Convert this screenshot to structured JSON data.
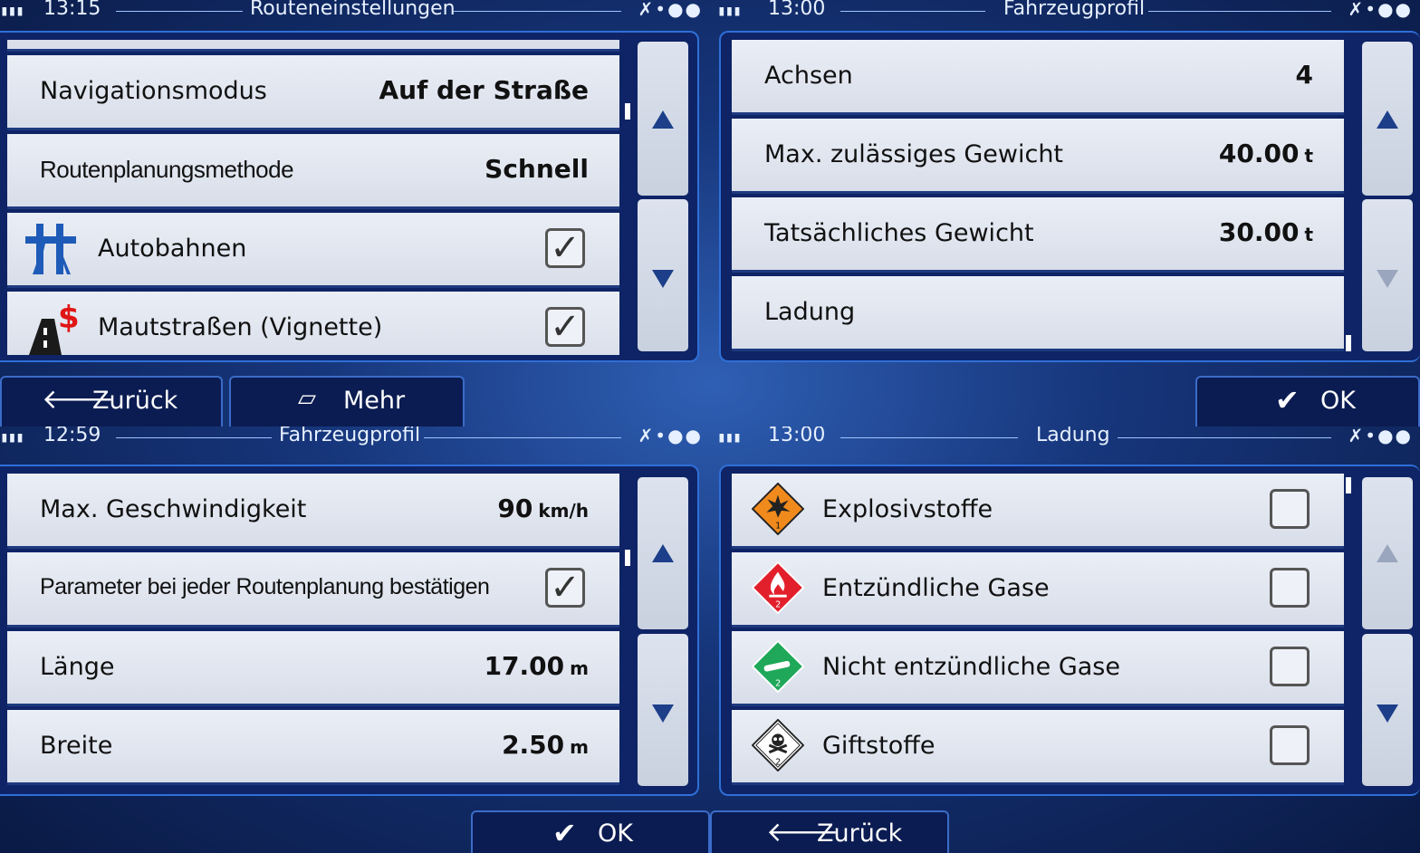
{
  "q0": {
    "status": {
      "clock": "13:15",
      "title": "Routeneinstellungen"
    },
    "rows": [
      {
        "label": "Navigationsmodus",
        "value": "Auf der Straße"
      },
      {
        "label": "Routenplanungsmethode",
        "value": "Schnell"
      },
      {
        "label": "Autobahnen",
        "checked": true,
        "icon": "highway-icon"
      },
      {
        "label": "Mautstraßen (Vignette)",
        "checked": true,
        "icon": "toll-road-icon"
      }
    ],
    "buttons": {
      "back": "Zurück",
      "more": "Mehr"
    }
  },
  "q1": {
    "status": {
      "clock": "13:00",
      "title": "Fahrzeugprofil"
    },
    "rows": [
      {
        "label": "Achsen",
        "value": "4"
      },
      {
        "label": "Max. zulässiges Gewicht",
        "value": "40.00",
        "unit": "t"
      },
      {
        "label": "Tatsächliches Gewicht",
        "value": "30.00",
        "unit": "t"
      },
      {
        "label": "Ladung"
      }
    ],
    "buttons": {
      "ok": "OK"
    }
  },
  "q2": {
    "status": {
      "clock": "12:59",
      "title": "Fahrzeugprofil"
    },
    "rows": [
      {
        "label": "Max. Geschwindigkeit",
        "value": "90",
        "unit": "km/h"
      },
      {
        "label": "Parameter bei jeder Routenplanung bestätigen",
        "checked": true
      },
      {
        "label": "Länge",
        "value": "17.00",
        "unit": "m"
      },
      {
        "label": "Breite",
        "value": "2.50",
        "unit": "m"
      }
    ],
    "buttons": {
      "ok": "OK"
    }
  },
  "q3": {
    "status": {
      "clock": "13:00",
      "title": "Ladung"
    },
    "rows": [
      {
        "label": "Explosivstoffe",
        "checked": false,
        "icon": "explosive-hazard-icon"
      },
      {
        "label": "Entzündliche Gase",
        "checked": false,
        "icon": "flammable-gas-hazard-icon"
      },
      {
        "label": "Nicht entzündliche Gase",
        "checked": false,
        "icon": "non-flammable-gas-hazard-icon"
      },
      {
        "label": "Giftstoffe",
        "checked": false,
        "icon": "toxic-hazard-icon"
      }
    ],
    "buttons": {
      "back": "Zurück"
    }
  },
  "colors": {
    "row_bg": "#e2e7f0",
    "panel_bg": "#0f2466",
    "accent_arrow": "#1d3f8a",
    "button_bg": "#0b1c52"
  }
}
